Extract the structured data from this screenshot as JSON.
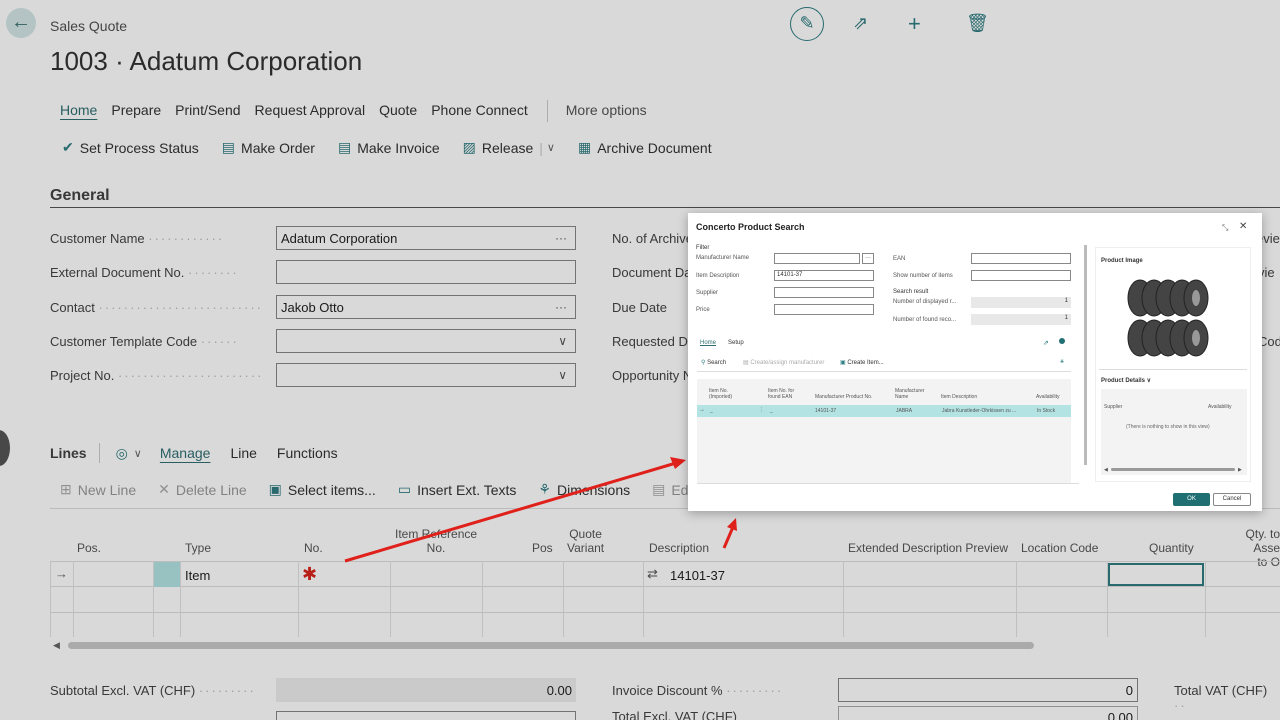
{
  "header": {
    "breadcrumb": "Sales Quote",
    "title": "1003 · Adatum Corporation"
  },
  "tabs": [
    {
      "label": "Home"
    },
    {
      "label": "Prepare"
    },
    {
      "label": "Print/Send"
    },
    {
      "label": "Request Approval"
    },
    {
      "label": "Quote"
    },
    {
      "label": "Phone Connect"
    }
  ],
  "more_options": "More options",
  "actions": {
    "set_process_status": "Set Process Status",
    "make_order": "Make Order",
    "make_invoice": "Make Invoice",
    "release": "Release",
    "archive_document": "Archive Document"
  },
  "general": {
    "title": "General",
    "customer_name_label": "Customer Name",
    "customer_name_value": "Adatum Corporation",
    "external_doc_label": "External Document No.",
    "contact_label": "Contact",
    "contact_value": "Jakob Otto",
    "customer_template_label": "Customer Template Code",
    "project_no_label": "Project No.",
    "no_of_archived_label": "No. of Archive",
    "document_date_label": "Document Da",
    "due_date_label": "Due Date",
    "requested_label": "Requested De",
    "opportunity_label": "Opportunity N",
    "right_clip_1": "evie",
    "right_clip_2": "vie",
    "right_clip_3": "Cod"
  },
  "lines": {
    "title": "Lines",
    "manage": "Manage",
    "line": "Line",
    "functions": "Functions",
    "new_line": "New Line",
    "delete_line": "Delete Line",
    "select_items": "Select items...",
    "insert_ext_texts": "Insert Ext. Texts",
    "dimensions": "Dimensions",
    "edit_bundle": "Edit Bundl",
    "columns": {
      "pos": "Pos.",
      "type": "Type",
      "no": "No.",
      "item_reference": "Item Reference",
      "item_reference_2": "No.",
      "pos2": "Pos",
      "quote_variant": "Quote",
      "quote_variant_2": "Variant",
      "description": "Description",
      "ext_desc": "Extended Description Preview",
      "location": "Location Code",
      "quantity": "Quantity",
      "qty_assemble": "Qty. to Asse",
      "qty_assemble_2": "to O"
    },
    "row1": {
      "type": "Item",
      "description": "14101-37"
    }
  },
  "totals": {
    "subtotal_label": "Subtotal Excl. VAT (CHF)",
    "subtotal_value": "0.00",
    "invoice_discount_label": "Invoice Discount %",
    "invoice_discount_value": "0",
    "total_excl_label": "Total Excl. VAT (CHF)",
    "total_excl_value": "0.00",
    "total_vat_label": "Total VAT (CHF)"
  },
  "dialog": {
    "title": "Concerto Product Search",
    "filter": "Filter",
    "manufacturer_name": "Manufacturer Name",
    "item_description": "Item Description",
    "item_description_value": "14101-37",
    "supplier": "Supplier",
    "price": "Price",
    "ean": "EAN",
    "show_number": "Show number of items",
    "search_result": "Search result",
    "num_displayed": "Number of displayed r...",
    "num_displayed_value": "1",
    "num_found": "Number of found reco...",
    "num_found_value": "1",
    "tab_home": "Home",
    "tab_setup": "Setup",
    "btn_search": "Search",
    "btn_create_assign": "Create/assign manufacturer",
    "btn_create_item": "Create Item...",
    "cols": {
      "item_no_imported": "Item No.",
      "item_no_imported_2": "(Imported)",
      "item_no_found": "Item No. for",
      "item_no_found_2": "found EAN",
      "manufacturer_product_no": "Manufacturer Product No.",
      "manufacturer": "Manufacturer",
      "manufacturer_2": "Name",
      "item_description": "Item Description",
      "availability": "Availability"
    },
    "row": {
      "imported": "_",
      "found": "_",
      "product_no": "14101-37",
      "manufacturer": "JABRA",
      "description": "Jabra Kunstleder-Ohrkissen zu ...",
      "availability": "In Stock"
    },
    "product_image": "Product Image",
    "product_details": "Product Details",
    "details_supplier": "Supplier",
    "details_availability": "Availability",
    "details_empty": "(There is nothing to show in this view)",
    "ok": "OK",
    "cancel": "Cancel"
  },
  "colors": {
    "accent": "#2f7d82",
    "arrow": "#e0201a",
    "selected_row": "#b3e3e3"
  }
}
